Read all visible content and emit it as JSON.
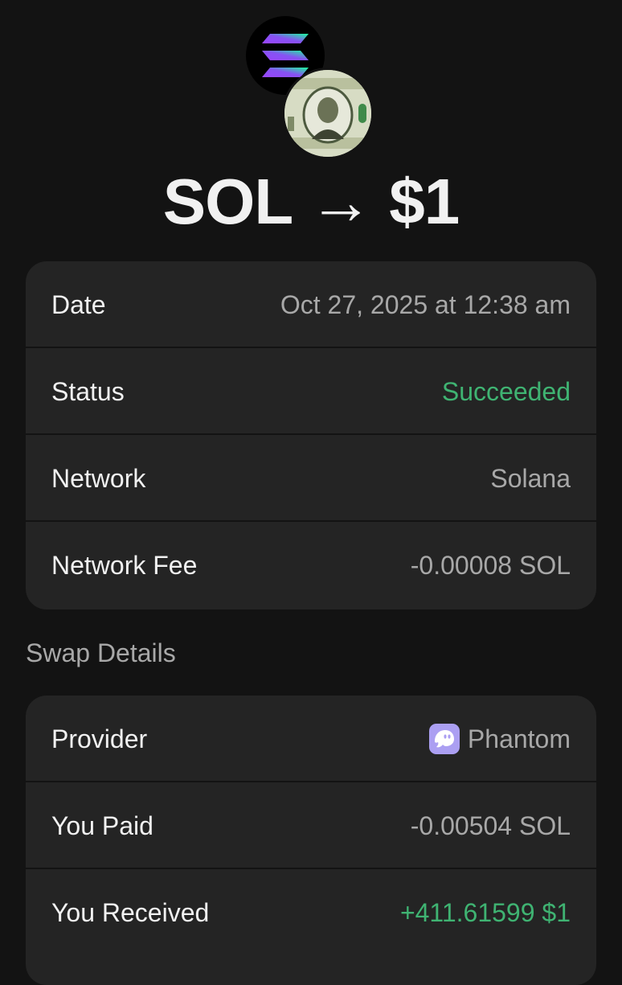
{
  "header": {
    "from_token_icon": "solana-logo-icon",
    "to_token_icon": "dollar-bill-icon",
    "title": "SOL → $1"
  },
  "details": {
    "rows": [
      {
        "label": "Date",
        "value": "Oct 27, 2025 at 12:38 am"
      },
      {
        "label": "Status",
        "value": "Succeeded",
        "color": "#3fb372"
      },
      {
        "label": "Network",
        "value": "Solana"
      },
      {
        "label": "Network Fee",
        "value": "-0.00008 SOL"
      }
    ]
  },
  "swap": {
    "section_title": "Swap Details",
    "provider": {
      "label": "Provider",
      "value": "Phantom",
      "icon": "phantom-ghost-icon"
    },
    "rows": [
      {
        "label": "You Paid",
        "value": "-0.00504 SOL"
      },
      {
        "label": "You Received",
        "value": "+411.61599 $1",
        "color": "#3fb372"
      }
    ]
  },
  "colors": {
    "background": "#131313",
    "card": "#242424",
    "success": "#3fb372",
    "muted_text": "#a8a8a8",
    "phantom_purple": "#ab9ff2"
  }
}
